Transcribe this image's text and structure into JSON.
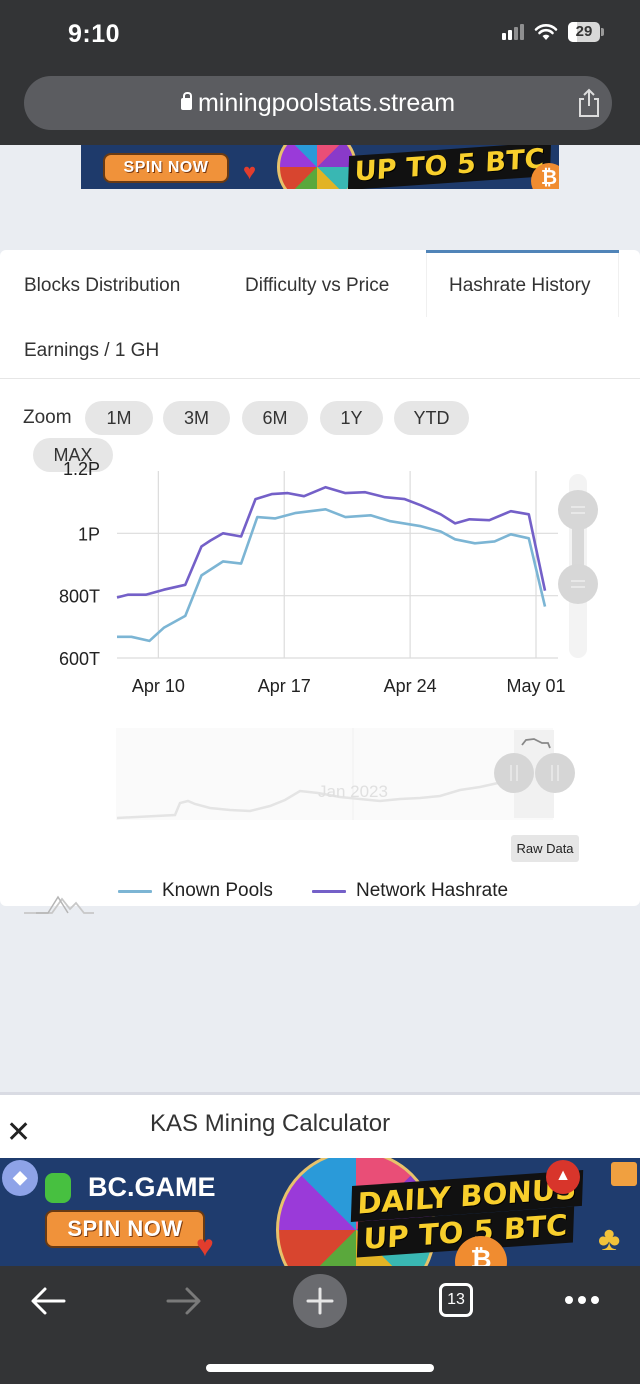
{
  "status_bar": {
    "time": "9:10",
    "battery": "29",
    "battery_level_percent": 29,
    "icons": [
      "cellular-signal-icon",
      "wifi-icon",
      "battery-icon"
    ]
  },
  "browser": {
    "url": "miningpoolstats.stream",
    "secure": true,
    "share_icon": "share-icon",
    "toolbar": {
      "back": "back-arrow-icon",
      "forward": "forward-arrow-icon",
      "new_tab": "plus-icon",
      "tab_count": "13",
      "more": "more-icon"
    }
  },
  "ads": {
    "top": {
      "button": "SPIN NOW",
      "headline": "UP TO 5 BTC"
    },
    "bottom": {
      "brand": "BC.GAME",
      "button": "SPIN NOW",
      "headline_line1": "DAILY BONUS",
      "headline_line2": "UP TO 5 BTC"
    }
  },
  "tabs": [
    {
      "label": "Blocks Distribution",
      "active": false
    },
    {
      "label": "Difficulty vs Price",
      "active": false
    },
    {
      "label": "Hashrate History",
      "active": true
    },
    {
      "label": "Earnings / 1 GH",
      "active": false
    }
  ],
  "accent_color": "#5084b8",
  "zoom": {
    "label": "Zoom",
    "buttons": [
      "1M",
      "3M",
      "6M",
      "1Y",
      "YTD",
      "MAX"
    ]
  },
  "chart_data": {
    "type": "line",
    "title": "Hashrate History",
    "xlabel": "",
    "ylabel": "",
    "x_unit": "day of April 2023 (May 01 = 31)",
    "xlim": [
      7.7,
      31.5
    ],
    "ylim": [
      600,
      1200
    ],
    "y_unit": "TH/s",
    "x_ticks": [
      {
        "value": 10,
        "label": "Apr 10"
      },
      {
        "value": 17,
        "label": "Apr 17"
      },
      {
        "value": 24,
        "label": "Apr 24"
      },
      {
        "value": 31,
        "label": "May 01"
      }
    ],
    "y_ticks": [
      {
        "value": 600,
        "label": "600T"
      },
      {
        "value": 800,
        "label": "800T"
      },
      {
        "value": 1000,
        "label": "1P"
      },
      {
        "value": 1200,
        "label": "1.2P"
      }
    ],
    "grid": true,
    "legend_position": "bottom",
    "series": [
      {
        "name": "Known Pools",
        "color": "#7cb5d4",
        "x": [
          7.7,
          8.5,
          9.5,
          10.3,
          11.5,
          12.4,
          13.6,
          14.6,
          15.5,
          16.5,
          17.6,
          19.3,
          20.4,
          21.8,
          22.9,
          24.6,
          25.7,
          26.5,
          27.6,
          28.7,
          29.6,
          30.6,
          31.5
        ],
        "values": [
          668,
          668,
          655,
          697,
          735,
          865,
          910,
          903,
          1052,
          1048,
          1065,
          1077,
          1052,
          1058,
          1039,
          1023,
          1006,
          981,
          968,
          974,
          997,
          984,
          765
        ]
      },
      {
        "name": "Network Hashrate",
        "color": "#7460c8",
        "x": [
          7.7,
          8.3,
          9.3,
          10.3,
          11.5,
          12.4,
          12.9,
          13.6,
          14.6,
          15.4,
          16.3,
          17.2,
          18.1,
          19.3,
          20.4,
          21.5,
          22.6,
          23.7,
          24.6,
          25.7,
          26.5,
          27.3,
          28.4,
          29.6,
          30.6,
          31.5
        ],
        "values": [
          794,
          803,
          803,
          819,
          835,
          958,
          977,
          1000,
          990,
          1110,
          1126,
          1129,
          1119,
          1148,
          1129,
          1132,
          1116,
          1110,
          1090,
          1061,
          1032,
          1045,
          1042,
          1071,
          1061,
          816
        ]
      }
    ],
    "navigator": {
      "label": "Jan 2023"
    }
  },
  "raw_data_button": "Raw Data",
  "bottom_panel": {
    "title": "KAS Mining Calculator",
    "close_icon": "close-icon"
  }
}
